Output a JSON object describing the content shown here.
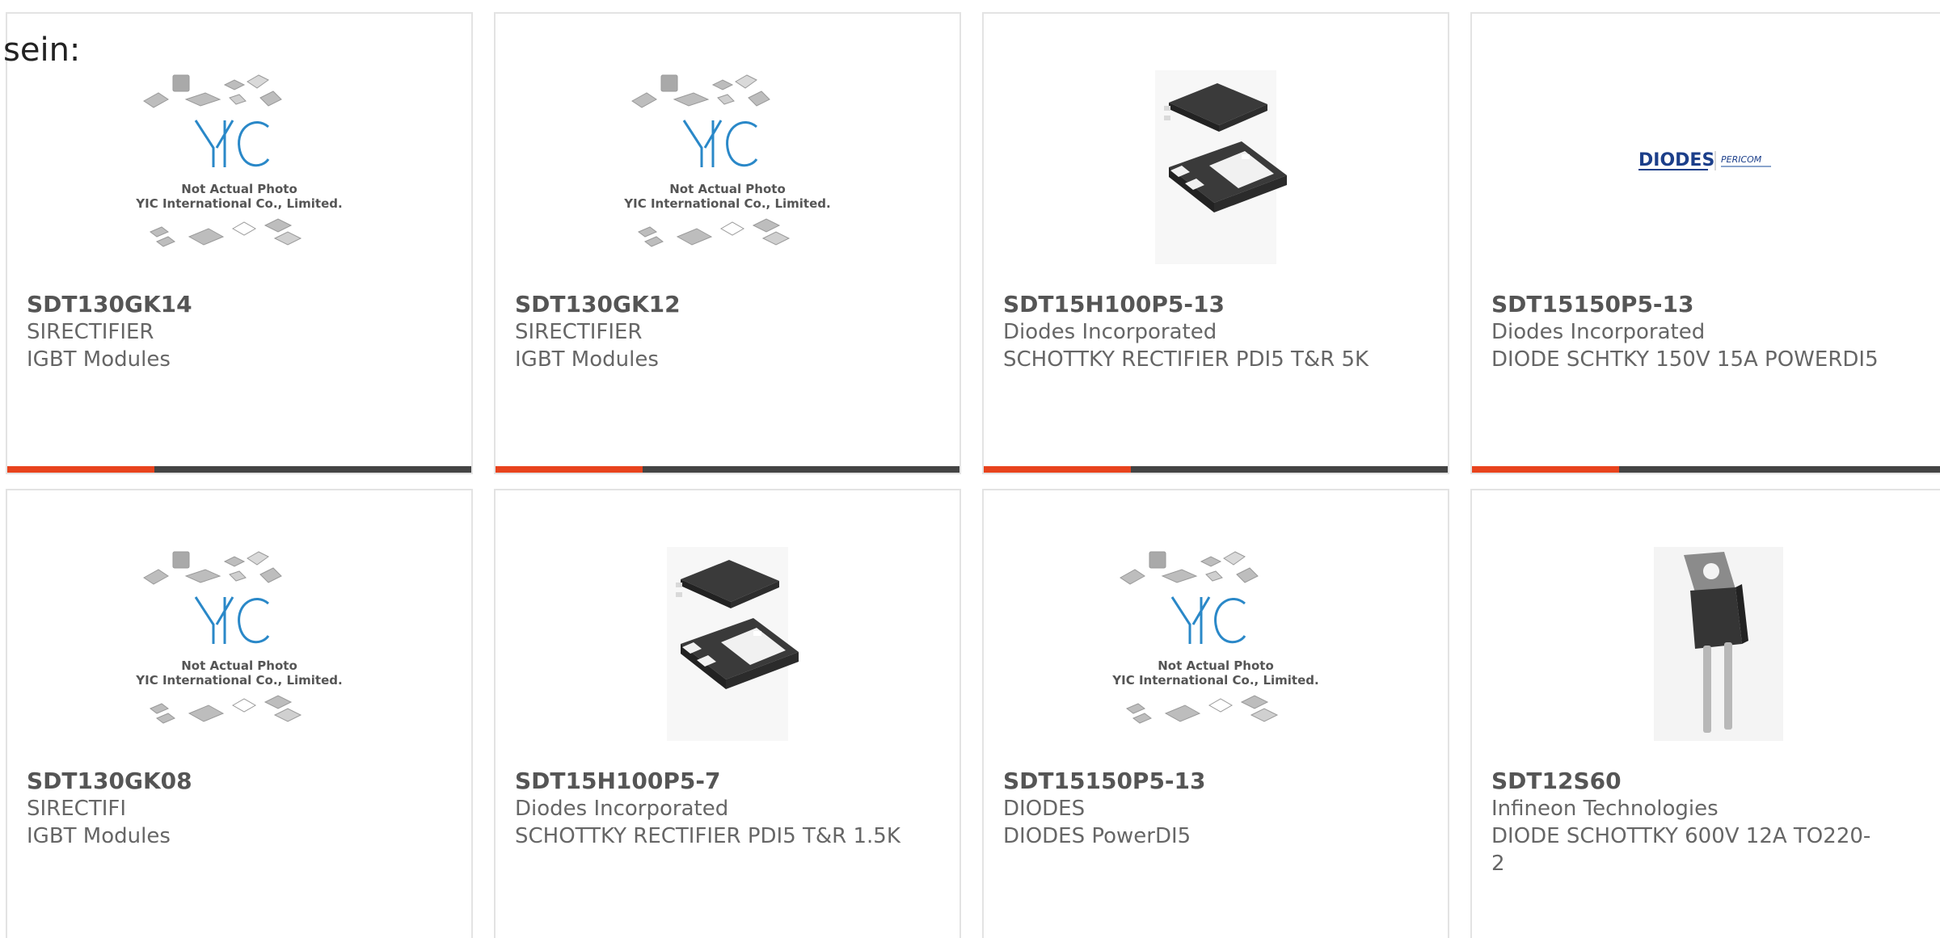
{
  "page": {
    "intro_text": "sein:"
  },
  "colors": {
    "accent": "#e8431d",
    "bar": "#444444",
    "yic_blue": "#2a88c8",
    "diodes_blue": "#1c3f8a"
  },
  "products": [
    {
      "part": "SDT130GK14",
      "maker": "SIRECTIFIER",
      "desc": "IGBT Modules",
      "image": "yic-placeholder",
      "placeholder_line1": "Not Actual Photo",
      "placeholder_line2": "YIC International Co., Limited."
    },
    {
      "part": "SDT130GK12",
      "maker": "SIRECTIFIER",
      "desc": "IGBT Modules",
      "image": "yic-placeholder",
      "placeholder_line1": "Not Actual Photo",
      "placeholder_line2": "YIC International Co., Limited."
    },
    {
      "part": "SDT15H100P5-13",
      "maker": "Diodes Incorporated",
      "desc": "SCHOTTKY RECTIFIER PDI5 T&R 5K",
      "image": "powerdi5-package"
    },
    {
      "part": "SDT15150P5-13",
      "maker": "Diodes Incorporated",
      "desc": "DIODE SCHTKY 150V 15A POWERDI5",
      "image": "diodes-pericom-logo",
      "logo_text_1": "DIODES",
      "logo_text_2": "PERICOM"
    },
    {
      "part": "SDT130GK08",
      "maker": "SIRECTIFI",
      "desc": "IGBT Modules",
      "image": "yic-placeholder",
      "placeholder_line1": "Not Actual Photo",
      "placeholder_line2": "YIC International Co., Limited."
    },
    {
      "part": "SDT15H100P5-7",
      "maker": "Diodes Incorporated",
      "desc": "SCHOTTKY RECTIFIER PDI5 T&R 1.5K",
      "image": "powerdi5-package"
    },
    {
      "part": "SDT15150P5-13",
      "maker": "DIODES",
      "desc": "DIODES PowerDI5",
      "image": "yic-placeholder",
      "placeholder_line1": "Not Actual Photo",
      "placeholder_line2": "YIC International Co., Limited."
    },
    {
      "part": "SDT12S60",
      "maker": "Infineon Technologies",
      "desc": "DIODE SCHOTTKY 600V 12A TO220-2",
      "image": "to220-package"
    }
  ]
}
